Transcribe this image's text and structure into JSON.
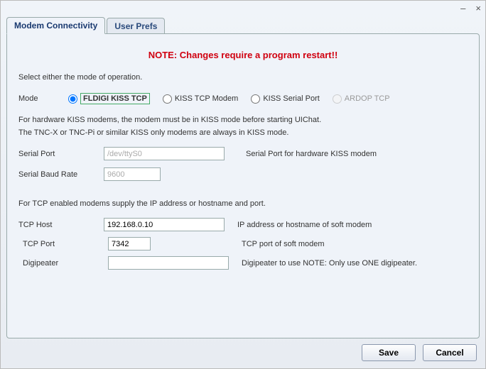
{
  "tabs": {
    "modem": "Modem Connectivity",
    "prefs": "User Prefs"
  },
  "note": "NOTE: Changes require a program restart!!",
  "intro": "Select either the mode of operation.",
  "mode": {
    "label": "Mode",
    "options": {
      "fldigi": "FLDIGI KISS TCP",
      "kisstcp": "KISS TCP Modem",
      "kisserial": "KISS Serial Port",
      "ardop": "ARDOP TCP"
    },
    "selected": "fldigi"
  },
  "kiss_info_line1": "For hardware KISS modems, the modem must be in KISS mode before starting UIChat.",
  "kiss_info_line2": "The TNC-X or TNC-Pi or similar KISS only modems are always in KISS mode.",
  "serial_port": {
    "label": "Serial Port",
    "value": "/dev/ttyS0",
    "hint": "Serial Port for hardware KISS modem"
  },
  "serial_baud": {
    "label": "Serial Baud Rate",
    "value": "9600"
  },
  "tcp_info": "For TCP enabled modems supply the IP address or hostname and port.",
  "tcp_host": {
    "label": "TCP Host",
    "value": "192.168.0.10",
    "hint": "IP address or hostname of soft modem"
  },
  "tcp_port": {
    "label": "TCP Port",
    "value": "7342",
    "hint": "TCP port of soft modem"
  },
  "digipeater": {
    "label": "Digipeater",
    "value": "",
    "hint": "Digipeater to use NOTE: Only use ONE digipeater."
  },
  "buttons": {
    "save": "Save",
    "cancel": "Cancel"
  }
}
